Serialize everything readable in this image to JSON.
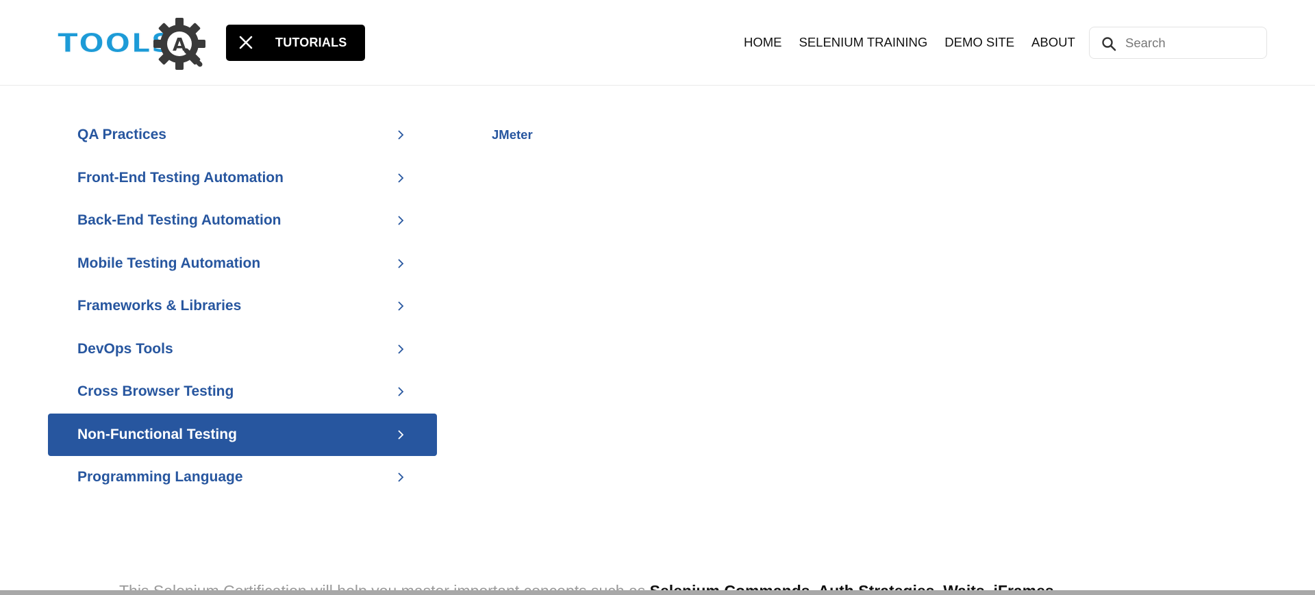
{
  "header": {
    "logo": {
      "text": "TOOLS",
      "badge_letter": "A",
      "icon": "gear-icon",
      "colors": {
        "text": "#1d9bd7",
        "gear": "#3a3a3a"
      }
    },
    "tutorials_button": {
      "label": "TUTORIALS",
      "icon": "close-icon",
      "background": "#000000"
    },
    "nav": [
      {
        "label": "HOME"
      },
      {
        "label": "SELENIUM TRAINING"
      },
      {
        "label": "DEMO SITE"
      },
      {
        "label": "ABOUT"
      }
    ],
    "search": {
      "placeholder": "Search",
      "value": "",
      "icon": "search-icon"
    }
  },
  "menu": {
    "items": [
      {
        "label": "QA Practices",
        "active": false
      },
      {
        "label": "Front-End Testing Automation",
        "active": false
      },
      {
        "label": "Back-End Testing Automation",
        "active": false
      },
      {
        "label": "Mobile Testing Automation",
        "active": false
      },
      {
        "label": "Frameworks & Libraries",
        "active": false
      },
      {
        "label": "DevOps Tools",
        "active": false
      },
      {
        "label": "Cross Browser Testing",
        "active": false
      },
      {
        "label": "Non-Functional Testing",
        "active": true
      },
      {
        "label": "Programming Language",
        "active": false
      }
    ],
    "icon": "chevron-right-icon",
    "colors": {
      "link": "#27569f",
      "active_bg": "#27569f",
      "active_text": "#ffffff"
    }
  },
  "submenu": {
    "items": [
      {
        "label": "JMeter"
      }
    ]
  },
  "background_content": {
    "text_start": "This Selenium Certification will help you master important concepts such as ",
    "text_bold": "Selenium Commands, Auth Strategies, Waits, iFrames,"
  }
}
